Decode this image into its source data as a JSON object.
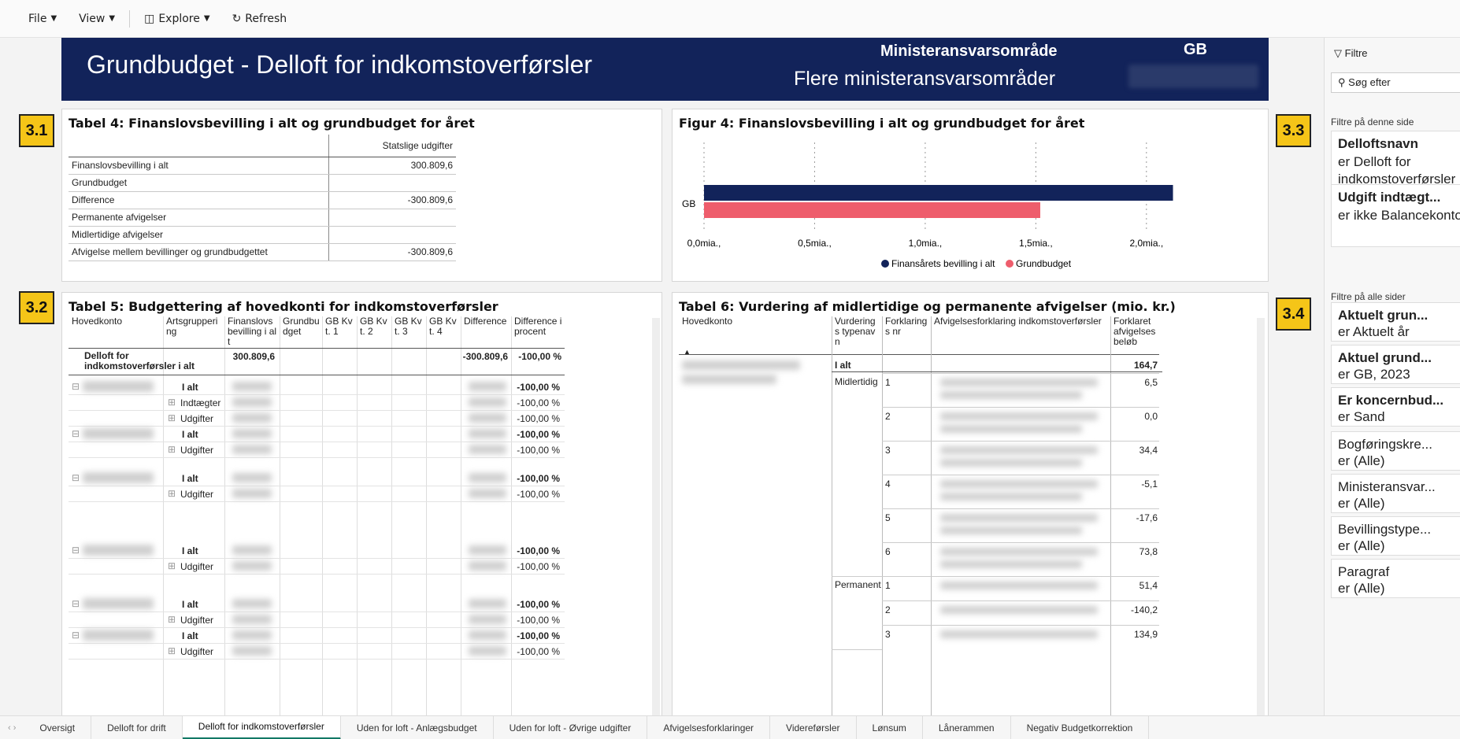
{
  "toolbar": {
    "file": "File",
    "view": "View",
    "explore": "Explore",
    "refresh": "Refresh"
  },
  "banner": {
    "title": "Grundbudget - Delloft for indkomstoverførsler",
    "ministry_header": "Ministeransvarsområde",
    "ministry_value": "Flere ministeransvarsområder",
    "gb": "GB"
  },
  "badges": [
    "3.1",
    "3.2",
    "3.3",
    "3.4"
  ],
  "table4": {
    "title": "Tabel 4: Finanslovsbevilling i alt og grundbudget for året",
    "col_header": "Statslige udgifter",
    "rows": [
      {
        "label": "Finanslovsbevilling i alt",
        "value": "300.809,6"
      },
      {
        "label": "Grundbudget",
        "value": ""
      },
      {
        "label": "Difference",
        "value": "-300.809,6"
      },
      {
        "label": "Permanente afvigelser",
        "value": ""
      },
      {
        "label": "Midlertidige afvigelser",
        "value": ""
      },
      {
        "label": "Afvigelse mellem bevillinger og grundbudgettet",
        "value": "-300.809,6"
      }
    ]
  },
  "figure4": {
    "title": "Figur 4: Finanslovsbevilling i alt og grundbudget for året"
  },
  "chart_data": {
    "type": "bar",
    "orientation": "horizontal",
    "categories": [
      "GB"
    ],
    "series": [
      {
        "name": "Finansårets bevilling i alt",
        "values": [
          2.12
        ],
        "color": "#12235a"
      },
      {
        "name": "Grundbudget",
        "values": [
          1.52
        ],
        "color": "#ee5d6c"
      }
    ],
    "xticks": [
      "0,0mia.,",
      "0,5mia.,",
      "1,0mia.,",
      "1,5mia.,",
      "2,0mia.,"
    ],
    "xlim": [
      0,
      2.2
    ],
    "legend_position": "bottom",
    "grid": true
  },
  "table5": {
    "title": "Tabel 5: Budgettering af hovedkonti for indkomstoverførsler",
    "headers": [
      "Hovedkonto",
      "Artsgruppering",
      "Finanslovsbevilling i alt",
      "Grundbudget",
      "GB Kvt. 1",
      "GB Kvt. 2",
      "GB Kvt. 3",
      "GB Kvt. 4",
      "Difference",
      "Difference i procent"
    ],
    "total_row": {
      "label": "Delloft for indkomstoverførsler i alt",
      "fin": "300.809,6",
      "diff": "-300.809,6",
      "pct": "-100,00 %"
    },
    "rows": [
      {
        "art": "I alt",
        "pct": "-100,00 %",
        "bold": true,
        "exp": "⊟"
      },
      {
        "art": "Indtægter",
        "pct": "-100,00 %",
        "bold": false,
        "exp": "⊞"
      },
      {
        "art": "Udgifter",
        "pct": "-100,00 %",
        "bold": false,
        "exp": "⊞"
      },
      {
        "art": "I alt",
        "pct": "-100,00 %",
        "bold": true,
        "exp": "⊟"
      },
      {
        "art": "Udgifter",
        "pct": "-100,00 %",
        "bold": false,
        "exp": "⊞"
      },
      {
        "art": "I alt",
        "pct": "-100,00 %",
        "bold": true,
        "exp": "⊟"
      },
      {
        "art": "Udgifter",
        "pct": "-100,00 %",
        "bold": false,
        "exp": "⊞"
      },
      {
        "art": "I alt",
        "pct": "-100,00 %",
        "bold": true,
        "exp": "⊟"
      },
      {
        "art": "Udgifter",
        "pct": "-100,00 %",
        "bold": false,
        "exp": "⊞"
      },
      {
        "art": "I alt",
        "pct": "-100,00 %",
        "bold": true,
        "exp": "⊟"
      },
      {
        "art": "Udgifter",
        "pct": "-100,00 %",
        "bold": false,
        "exp": "⊞"
      },
      {
        "art": "I alt",
        "pct": "-100,00 %",
        "bold": true,
        "exp": "⊟"
      },
      {
        "art": "Udgifter",
        "pct": "-100,00 %",
        "bold": false,
        "exp": "⊞"
      }
    ]
  },
  "table6": {
    "title": "Tabel 6: Vurdering af midlertidige og permanente afvigelser (mio. kr.)",
    "headers": [
      "Hovedkonto",
      "Vurderings typenavn",
      "Forklarings nr",
      "Afvigelsesforklaring indkomstoverførsler",
      "Forklaret afvigelses beløb"
    ],
    "total": {
      "label": "I alt",
      "value": "164,7"
    },
    "groups": [
      {
        "type": "Midlertidig",
        "rows": [
          {
            "nr": "1",
            "value": "6,5"
          },
          {
            "nr": "2",
            "value": "0,0"
          },
          {
            "nr": "3",
            "value": "34,4"
          },
          {
            "nr": "4",
            "value": "-5,1"
          },
          {
            "nr": "5",
            "value": "-17,6"
          },
          {
            "nr": "6",
            "value": "73,8"
          }
        ]
      },
      {
        "type": "Permanent",
        "rows": [
          {
            "nr": "1",
            "value": "51,4"
          },
          {
            "nr": "2",
            "value": "-140,2"
          },
          {
            "nr": "3",
            "value": "134,9"
          }
        ]
      }
    ]
  },
  "filters": {
    "title": "Filtre",
    "search_placeholder": "Søg efter",
    "page_section": "Filtre på denne side",
    "all_section": "Filtre på alle sider",
    "page_filters": [
      {
        "name": "Delloftsnavn",
        "value": "er Delloft for indkomstoverførsler"
      },
      {
        "name": "Udgift indtægt...",
        "value": "er ikke Balancekonto"
      }
    ],
    "all_filters": [
      {
        "name": "Aktuelt grun...",
        "value": "er Aktuelt år",
        "bold": true
      },
      {
        "name": "Aktuel grund...",
        "value": "er GB, 2023",
        "bold": true
      },
      {
        "name": "Er koncernbud...",
        "value": "er Sand",
        "bold": true
      },
      {
        "name": "Bogføringskre...",
        "value": "er (Alle)",
        "bold": false
      },
      {
        "name": "Ministeransvar...",
        "value": "er (Alle)",
        "bold": false
      },
      {
        "name": "Bevillingstype...",
        "value": "er (Alle)",
        "bold": false
      },
      {
        "name": "Paragraf",
        "value": "er (Alle)",
        "bold": false
      }
    ]
  },
  "tabs": [
    "Oversigt",
    "Delloft for drift",
    "Delloft for indkomstoverførsler",
    "Uden for loft - Anlægsbudget",
    "Uden for loft - Øvrige udgifter",
    "Afvigelsesforklaringer",
    "Videreførsler",
    "Lønsum",
    "Lånerammen",
    "Negativ Budgetkorrektion"
  ],
  "active_tab": "Delloft for indkomstoverførsler"
}
